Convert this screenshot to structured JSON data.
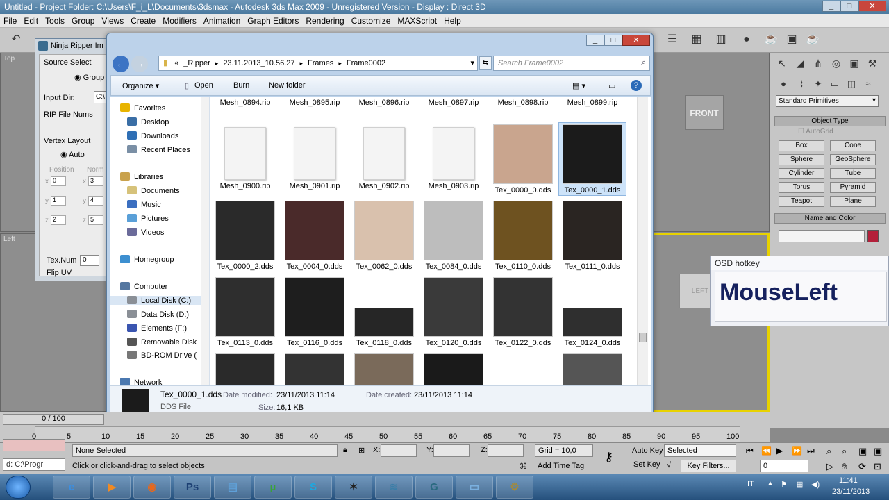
{
  "max": {
    "title": "Untitled    - Project Folder: C:\\Users\\F_i_L\\Documents\\3dsmax   - Autodesk 3ds Max  2009  - Unregistered Version   - Display : Direct 3D",
    "menu": [
      "File",
      "Edit",
      "Tools",
      "Group",
      "Views",
      "Create",
      "Modifiers",
      "Animation",
      "Graph Editors",
      "Rendering",
      "Customize",
      "MAXScript",
      "Help"
    ],
    "viewport_labels": {
      "top": "Top",
      "left": "Left",
      "front": "FRONT",
      "left_cube": "LEFT"
    }
  },
  "ninja": {
    "title": "Ninja Ripper Im",
    "source_select": "Source Select",
    "group": "Group",
    "input_dir": "Input Dir:",
    "input_dir_value": "C:\\",
    "rip_file_nums": "RIP File Nums",
    "vertex_layout": "Vertex Layout",
    "auto": "Auto",
    "position": "Position",
    "normal": "Norm",
    "x": "x",
    "y": "y",
    "z": "z",
    "vals": [
      "0",
      "3",
      "1",
      "4",
      "2",
      "5"
    ],
    "texnum": "Tex.Num",
    "texnum_value": "0",
    "flipuv": "Flip UV"
  },
  "explorer": {
    "breadcrumb": [
      "«",
      "_Ripper",
      "23.11.2013_10.56.27",
      "Frames",
      "Frame0002"
    ],
    "search_placeholder": "Search Frame0002",
    "commands": [
      "Organize ▾",
      "Open",
      "Burn",
      "New folder"
    ],
    "nav": [
      {
        "label": "Favorites",
        "icon": "star-icon",
        "color": "#e8b400"
      },
      {
        "label": "Desktop",
        "icon": "desktop-icon",
        "color": "#3a6ea5"
      },
      {
        "label": "Downloads",
        "icon": "download-icon",
        "color": "#2f6fb5"
      },
      {
        "label": "Recent Places",
        "icon": "recent-icon",
        "color": "#7a8fa5"
      },
      {
        "label": "Libraries",
        "icon": "library-icon",
        "color": "#c9a24d"
      },
      {
        "label": "Documents",
        "icon": "document-icon",
        "color": "#d6c27a"
      },
      {
        "label": "Music",
        "icon": "music-icon",
        "color": "#3b6fc0"
      },
      {
        "label": "Pictures",
        "icon": "picture-icon",
        "color": "#5aa0d8"
      },
      {
        "label": "Videos",
        "icon": "video-icon",
        "color": "#6b6b9a"
      },
      {
        "label": "Homegroup",
        "icon": "homegroup-icon",
        "color": "#3d8fd0"
      },
      {
        "label": "Computer",
        "icon": "computer-icon",
        "color": "#5577a0"
      },
      {
        "label": "Local Disk (C:)",
        "icon": "disk-icon",
        "color": "#8a8f96"
      },
      {
        "label": "Data Disk (D:)",
        "icon": "disk-icon",
        "color": "#8a8f96"
      },
      {
        "label": "Elements (F:)",
        "icon": "disk-icon",
        "color": "#3a55b0"
      },
      {
        "label": "Removable Disk",
        "icon": "usb-icon",
        "color": "#555"
      },
      {
        "label": "BD-ROM Drive (",
        "icon": "optical-drive-icon",
        "color": "#777"
      },
      {
        "label": "Network",
        "icon": "network-icon",
        "color": "#4a78b0"
      }
    ],
    "files": [
      {
        "name": "Mesh_0894.rip",
        "kind": "cut",
        "color": "#f2f2f2"
      },
      {
        "name": "Mesh_0895.rip",
        "kind": "cut",
        "color": "#f2f2f2"
      },
      {
        "name": "Mesh_0896.rip",
        "kind": "cut",
        "color": "#f2f2f2"
      },
      {
        "name": "Mesh_0897.rip",
        "kind": "cut",
        "color": "#f2f2f2"
      },
      {
        "name": "Mesh_0898.rip",
        "kind": "cut",
        "color": "#f2f2f2"
      },
      {
        "name": "Mesh_0899.rip",
        "kind": "cut",
        "color": "#f2f2f2"
      },
      {
        "name": "Mesh_0900.rip",
        "kind": "doc",
        "color": "#f4f4f4"
      },
      {
        "name": "Mesh_0901.rip",
        "kind": "doc",
        "color": "#f4f4f4"
      },
      {
        "name": "Mesh_0902.rip",
        "kind": "doc",
        "color": "#f4f4f4"
      },
      {
        "name": "Mesh_0903.rip",
        "kind": "doc",
        "color": "#f4f4f4"
      },
      {
        "name": "Tex_0000_0.dds",
        "kind": "tex",
        "color": "#c9a58e"
      },
      {
        "name": "Tex_0000_1.dds",
        "kind": "tex",
        "color": "#1b1b1b",
        "selected": true
      },
      {
        "name": "Tex_0000_2.dds",
        "kind": "tex",
        "color": "#2a2a2a"
      },
      {
        "name": "Tex_0004_0.dds",
        "kind": "tex",
        "color": "#4a2a2a"
      },
      {
        "name": "Tex_0062_0.dds",
        "kind": "tex",
        "color": "#d9c1ad"
      },
      {
        "name": "Tex_0084_0.dds",
        "kind": "tex",
        "color": "#bdbdbd"
      },
      {
        "name": "Tex_0110_0.dds",
        "kind": "tex",
        "color": "#6e5220"
      },
      {
        "name": "Tex_0111_0.dds",
        "kind": "tex",
        "color": "#2a2522"
      },
      {
        "name": "Tex_0113_0.dds",
        "kind": "tex",
        "color": "#2e2e2e"
      },
      {
        "name": "Tex_0116_0.dds",
        "kind": "tex",
        "color": "#1e1e1e"
      },
      {
        "name": "Tex_0118_0.dds",
        "kind": "tex",
        "color": "#262626"
      },
      {
        "name": "Tex_0120_0.dds",
        "kind": "tex",
        "color": "#3a3a3a"
      },
      {
        "name": "Tex_0122_0.dds",
        "kind": "tex",
        "color": "#333333"
      },
      {
        "name": "Tex_0124_0.dds",
        "kind": "tex",
        "color": "#2f2f2f"
      },
      {
        "name": "",
        "kind": "tex",
        "color": "#2a2a2a"
      },
      {
        "name": "",
        "kind": "tex",
        "color": "#333"
      },
      {
        "name": "",
        "kind": "tex",
        "color": "#7a6a5a"
      },
      {
        "name": "",
        "kind": "tex",
        "color": "#1a1a1a"
      },
      {
        "name": "",
        "kind": "none",
        "color": "#fff"
      },
      {
        "name": "",
        "kind": "tex",
        "color": "#555"
      }
    ],
    "details": {
      "name": "Tex_0000_1.dds",
      "type": "DDS File",
      "date_modified_label": "Date modified:",
      "date_modified": "23/11/2013 11:14",
      "date_created_label": "Date created:",
      "date_created": "23/11/2013 11:14",
      "size_label": "Size:",
      "size": "16,1 KB"
    }
  },
  "command_panel": {
    "dropdown": "Standard Primitives",
    "object_type": "Object Type",
    "autogrid": "AutoGrid",
    "buttons": [
      "Box",
      "Cone",
      "Sphere",
      "GeoSphere",
      "Cylinder",
      "Tube",
      "Torus",
      "Pyramid",
      "Teapot",
      "Plane"
    ],
    "name_and_color": "Name and Color",
    "color": "#b3203a"
  },
  "osd": {
    "header": "OSD hotkey",
    "text": "MouseLeft"
  },
  "timeline": {
    "frame": "0 / 100",
    "ticks": [
      "0",
      "5",
      "10",
      "15",
      "20",
      "25",
      "30",
      "35",
      "40",
      "45",
      "50",
      "55",
      "60",
      "65",
      "70",
      "75",
      "80",
      "85",
      "90",
      "95",
      "100"
    ]
  },
  "status": {
    "cmd": "d: C:\\Progr",
    "none_selected": "None Selected",
    "hint": "Click or click-and-drag to select objects",
    "x": "X:",
    "y": "Y:",
    "z": "Z:",
    "grid": "Grid = 10,0",
    "add_time_tag": "Add Time Tag",
    "auto_key": "Auto Key",
    "set_key": "Set Key",
    "selected": "Selected",
    "key_filters": "Key Filters...",
    "frame_field": "0"
  },
  "taskbar": {
    "apps": [
      {
        "name": "ie-icon",
        "glyph": "e",
        "color": "#3c8ee0"
      },
      {
        "name": "media-icon",
        "glyph": "▶",
        "color": "#f08a24"
      },
      {
        "name": "firefox-icon",
        "glyph": "◉",
        "color": "#e8681c"
      },
      {
        "name": "photoshop-icon",
        "glyph": "Ps",
        "color": "#1c3f73"
      },
      {
        "name": "network-tool-icon",
        "glyph": "▤",
        "color": "#5fa0d8"
      },
      {
        "name": "utorrent-icon",
        "glyph": "µ",
        "color": "#3aa23a"
      },
      {
        "name": "skype-icon",
        "glyph": "S",
        "color": "#1ea8e0"
      },
      {
        "name": "ninja-icon",
        "glyph": "✶",
        "color": "#222"
      },
      {
        "name": "3dsmax-tool-icon",
        "glyph": "≋",
        "color": "#3a7ea8"
      },
      {
        "name": "3dsmax-icon",
        "glyph": "G",
        "color": "#2a6a80"
      },
      {
        "name": "notepad-icon",
        "glyph": "▭",
        "color": "#7ab0e0"
      },
      {
        "name": "tools-icon",
        "glyph": "⚙",
        "color": "#a08a40"
      }
    ],
    "lang": "IT",
    "time": "11:41",
    "date": "23/11/2013"
  }
}
